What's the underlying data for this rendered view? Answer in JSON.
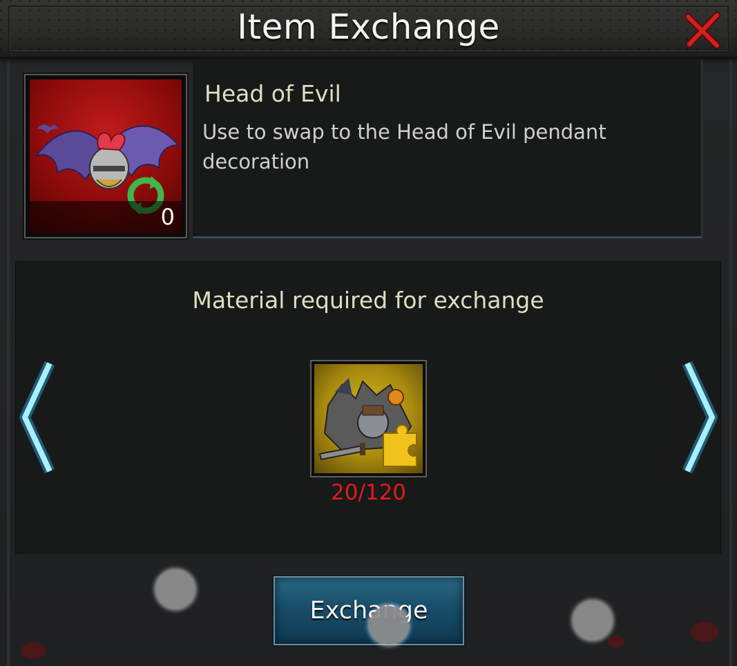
{
  "dialog": {
    "title": "Item Exchange"
  },
  "item": {
    "name": "Head of Evil",
    "description": "Use to swap to the Head of Evil pendant decoration",
    "count": "0",
    "icon": "bat-helmet-swap-icon"
  },
  "material": {
    "heading": "Material required for exchange",
    "progress": "20/120",
    "owned": 20,
    "required": 120,
    "icon": "equipment-pile-puzzle-icon"
  },
  "actions": {
    "exchange_label": "Exchange"
  },
  "colors": {
    "accent_text": "#dde0bf",
    "insufficient": "#e21c1c",
    "button": "#1d5570",
    "arrow_glow": "#79e3ff"
  }
}
